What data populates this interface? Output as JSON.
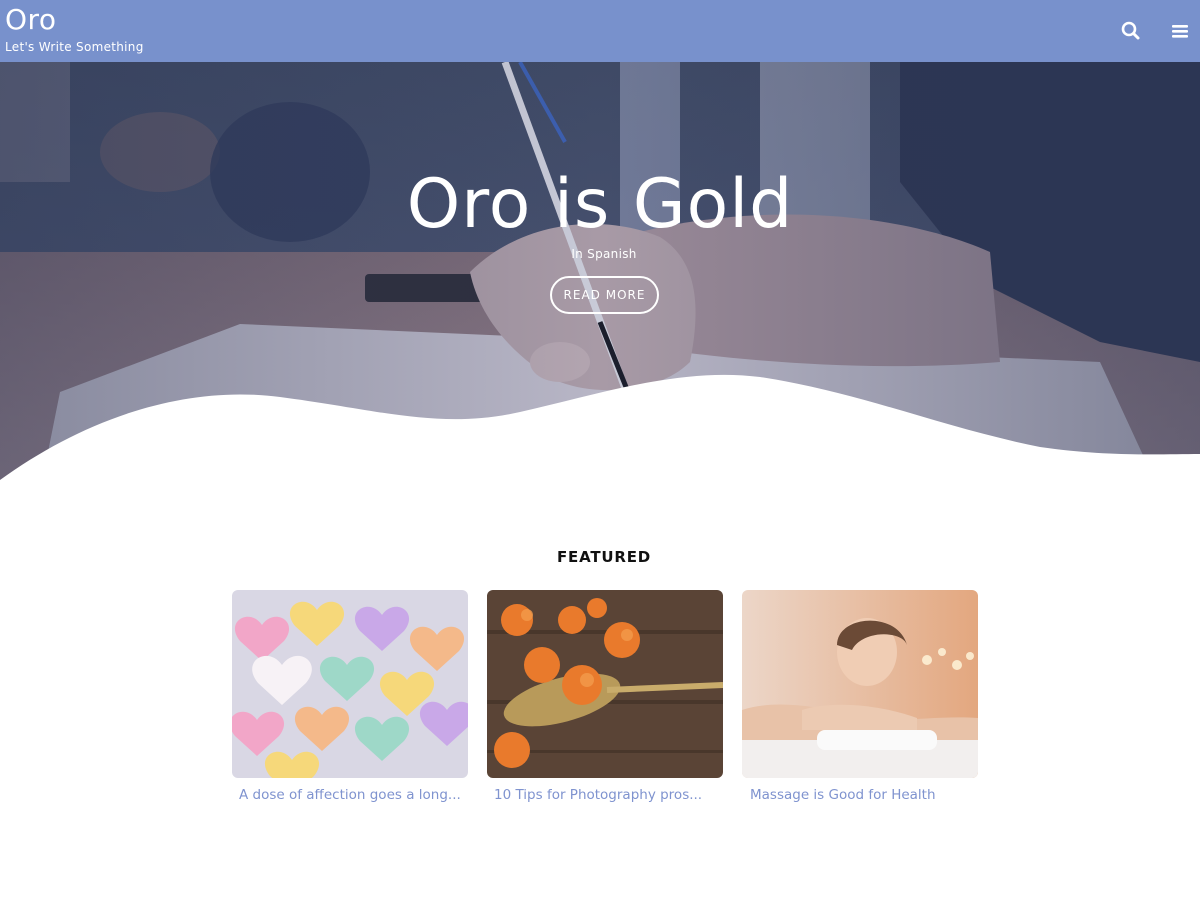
{
  "header": {
    "site_title": "Oro",
    "tagline": "Let's Write Something",
    "icons": {
      "search": "search-icon",
      "menu": "hamburger-menu-icon"
    },
    "bg_color": "#7891cc"
  },
  "hero": {
    "title": "Oro is Gold",
    "subtitle": "In Spanish",
    "button_label": "READ MORE",
    "image": "hand-writing-with-pen-photo"
  },
  "featured": {
    "heading": "FEATURED",
    "cards": [
      {
        "title": "A dose of affection goes a long...",
        "image": "candy-hearts-photo"
      },
      {
        "title": "10 Tips for Photography pros...",
        "image": "orange-flowers-on-spoon-photo"
      },
      {
        "title": "Massage is Good for Health",
        "image": "woman-at-spa-photo"
      }
    ],
    "link_color": "#7f93cf"
  }
}
